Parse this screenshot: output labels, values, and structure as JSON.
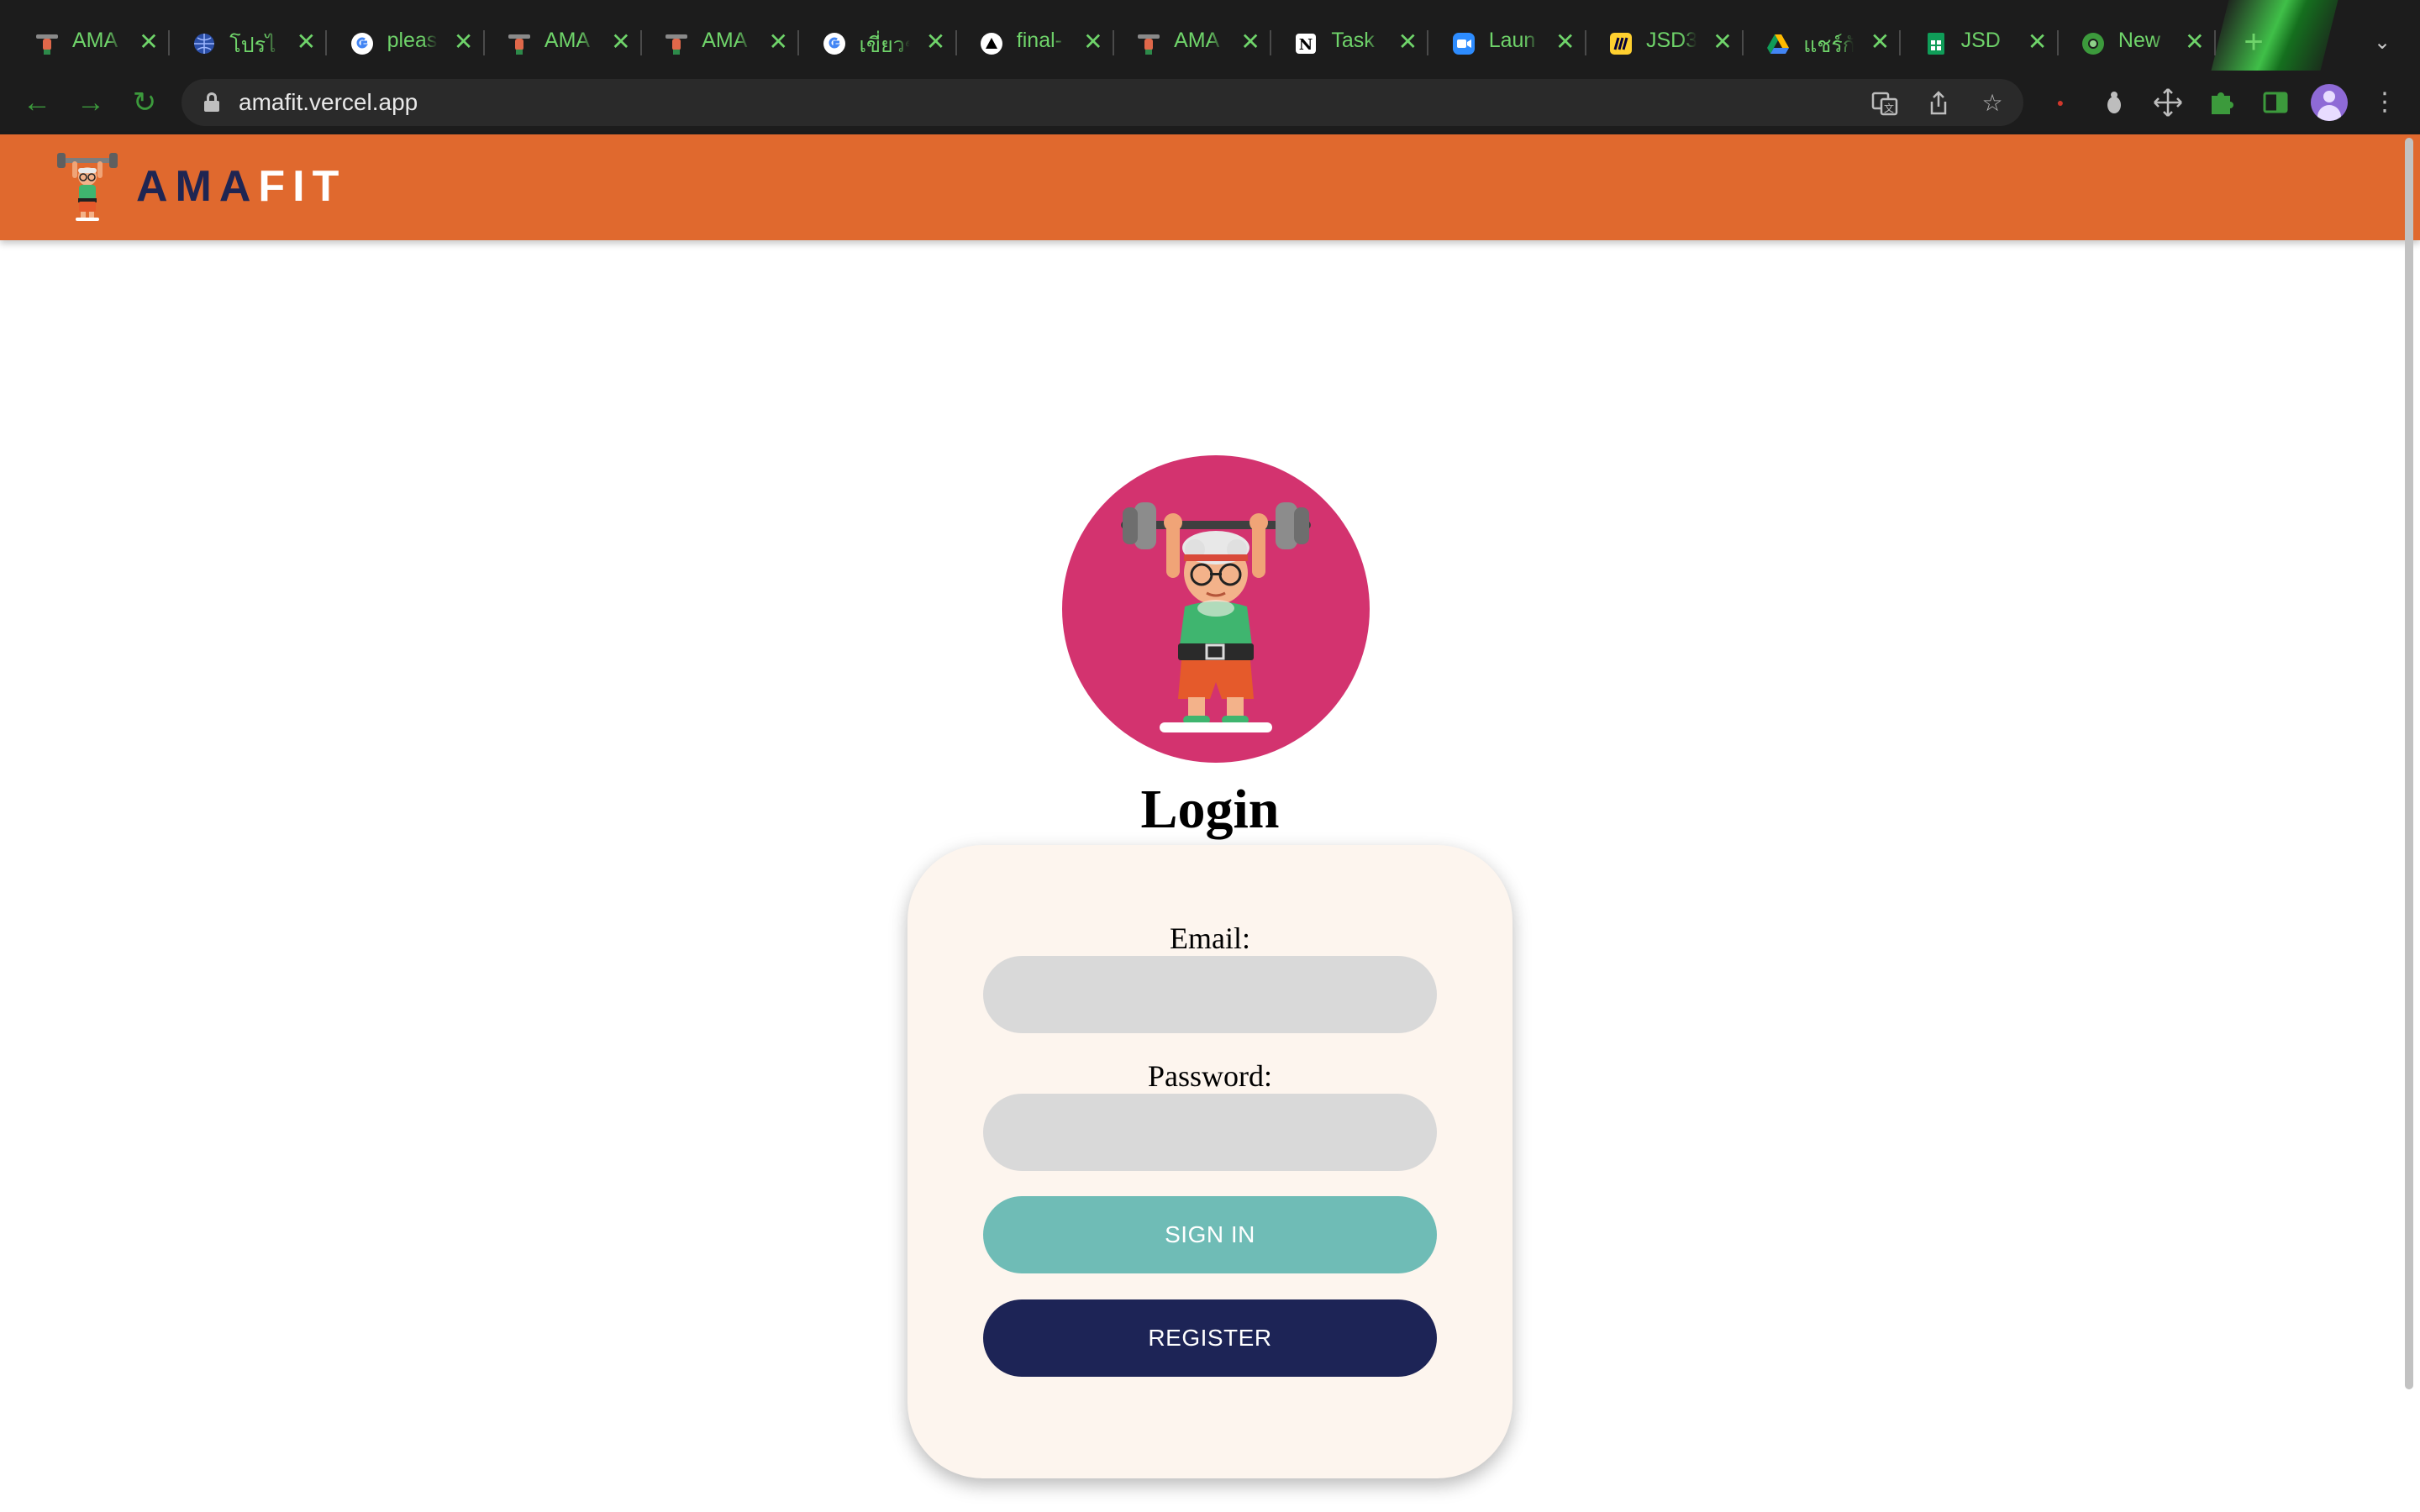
{
  "browser": {
    "tabs": [
      {
        "title": "AMA",
        "icon": "dumbbell-icon"
      },
      {
        "title": "โปรไ",
        "icon": "globe-icon"
      },
      {
        "title": "pleas",
        "icon": "google-icon"
      },
      {
        "title": "AMA",
        "icon": "dumbbell-icon"
      },
      {
        "title": "AMA",
        "icon": "dumbbell-icon"
      },
      {
        "title": "เขี่ยวข",
        "icon": "google-icon"
      },
      {
        "title": "final-",
        "icon": "vercel-icon"
      },
      {
        "title": "AMA",
        "icon": "dumbbell-icon"
      },
      {
        "title": "Task",
        "icon": "notion-icon"
      },
      {
        "title": "Laun",
        "icon": "zoom-icon"
      },
      {
        "title": "JSD3",
        "icon": "miro-icon"
      },
      {
        "title": "แชร์กั",
        "icon": "drive-icon"
      },
      {
        "title": "JSD",
        "icon": "sheets-icon"
      },
      {
        "title": "New",
        "icon": "chrome-icon"
      }
    ],
    "close_glyph": "✕",
    "new_tab_glyph": "+",
    "url": "amafit.vercel.app",
    "tab_text_color": "#6fd46a"
  },
  "header": {
    "brand_part1": "AMA",
    "brand_part2": "FIT",
    "bg_color": "#e0692e"
  },
  "login": {
    "title": "Login",
    "email_label": "Email:",
    "email_value": "",
    "password_label": "Password:",
    "password_value": "",
    "signin_label": "SIGN IN",
    "register_label": "REGISTER",
    "signin_color": "#6fbcb6",
    "register_color": "#1d2456",
    "mascot_bg": "#d3336f"
  }
}
